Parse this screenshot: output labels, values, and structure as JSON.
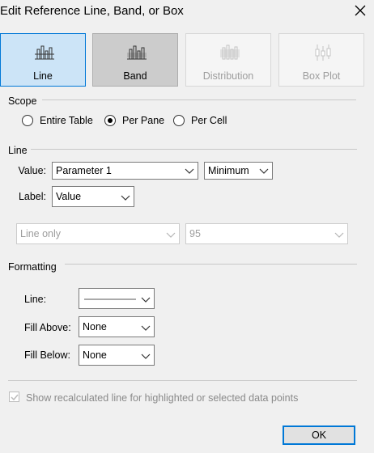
{
  "window": {
    "title": "Edit Reference Line, Band, or Box"
  },
  "tabs": [
    {
      "label": "Line",
      "icon": "line-chart-icon",
      "state": "selected"
    },
    {
      "label": "Band",
      "icon": "band-chart-icon",
      "state": "normal"
    },
    {
      "label": "Distribution",
      "icon": "distribution-chart-icon",
      "state": "disabled"
    },
    {
      "label": "Box Plot",
      "icon": "box-plot-icon",
      "state": "disabled"
    }
  ],
  "scope": {
    "heading": "Scope",
    "options": [
      "Entire Table",
      "Per Pane",
      "Per Cell"
    ],
    "selected": "Per Pane"
  },
  "line": {
    "heading": "Line",
    "value_label": "Value:",
    "value": "Parameter 1",
    "aggregation": "Minimum",
    "label_label": "Label:",
    "label_value": "Value",
    "line_only": "Line only",
    "percent": "95"
  },
  "formatting": {
    "heading": "Formatting",
    "line_label": "Line:",
    "fill_above_label": "Fill Above:",
    "fill_above_value": "None",
    "fill_below_label": "Fill Below:",
    "fill_below_value": "None"
  },
  "footer": {
    "checkbox_label": "Show recalculated line for highlighted or selected data points",
    "checkbox_checked": true,
    "checkbox_disabled": true,
    "ok_label": "OK"
  },
  "colors": {
    "accent": "#0078d7",
    "selected_tab_bg": "#cce4f7",
    "disabled_text": "#9d9d9d"
  }
}
